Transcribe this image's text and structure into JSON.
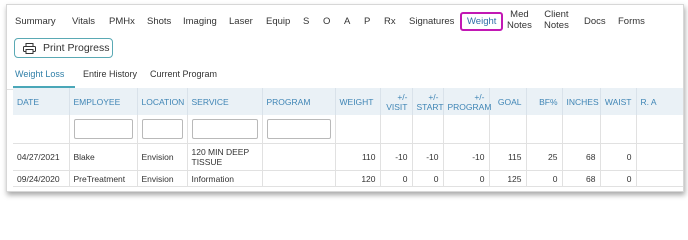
{
  "topnav": {
    "items": [
      {
        "label": "Summary"
      },
      {
        "label": "Vitals"
      },
      {
        "label": "PMHx"
      },
      {
        "label": "Shots"
      },
      {
        "label": "Imaging"
      },
      {
        "label": "Laser"
      },
      {
        "label": "Equip"
      },
      {
        "label": "S"
      },
      {
        "label": "O"
      },
      {
        "label": "A"
      },
      {
        "label": "P"
      },
      {
        "label": "Rx"
      },
      {
        "label": "Signatures"
      },
      {
        "label": "Weight",
        "active": true
      },
      {
        "label_line1": "Med",
        "label_line2": "Notes"
      },
      {
        "label_line1": "Client",
        "label_line2": "Notes"
      },
      {
        "label": "Docs"
      },
      {
        "label": "Forms"
      }
    ]
  },
  "toolbar": {
    "print_label": "Print Progress",
    "print_icon": "printer-icon"
  },
  "subtabs": [
    {
      "label": "Weight Loss",
      "active": true
    },
    {
      "label": "Entire History"
    },
    {
      "label": "Current Program"
    }
  ],
  "table": {
    "columns": [
      {
        "l1": "DATE",
        "l2": ""
      },
      {
        "l1": "EMPLOYEE",
        "l2": ""
      },
      {
        "l1": "LOCATION",
        "l2": ""
      },
      {
        "l1": "SERVICE",
        "l2": ""
      },
      {
        "l1": "PROGRAM",
        "l2": ""
      },
      {
        "l1": "WEIGHT",
        "l2": ""
      },
      {
        "l1": "+/-",
        "l2": "VISIT"
      },
      {
        "l1": "+/-",
        "l2": "START"
      },
      {
        "l1": "+/-",
        "l2": "PROGRAM"
      },
      {
        "l1": "GOAL",
        "l2": ""
      },
      {
        "l1": "BF%",
        "l2": ""
      },
      {
        "l1": "INCHES",
        "l2": ""
      },
      {
        "l1": "WAIST",
        "l2": ""
      },
      {
        "l1": "R. A",
        "l2": ""
      }
    ],
    "rows": [
      {
        "date": "04/27/2021",
        "employee": "Blake",
        "location": "Envision",
        "service_l1": "120 MIN DEEP",
        "service_l2": "TISSUE",
        "program": "",
        "weight": "110",
        "visit": "-10",
        "start": "-10",
        "prog": "-10",
        "goal": "115",
        "bf": "25",
        "inches": "68",
        "waist": "0"
      },
      {
        "date": "09/24/2020",
        "employee": "PreTreatment",
        "location": "Envision",
        "service_l1": "Information",
        "service_l2": "",
        "program": "",
        "weight": "120",
        "visit": "0",
        "start": "0",
        "prog": "0",
        "goal": "125",
        "bf": "0",
        "inches": "68",
        "waist": "0"
      }
    ]
  }
}
